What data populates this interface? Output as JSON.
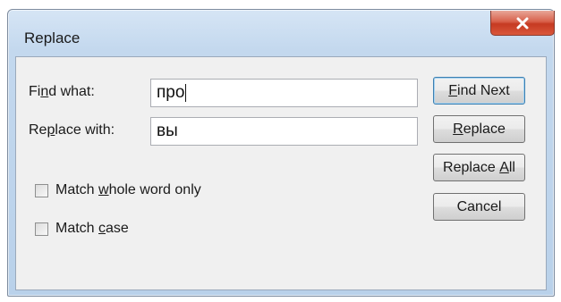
{
  "window": {
    "title": "Replace"
  },
  "find": {
    "label_pre": "Fi",
    "label_key": "n",
    "label_post": "d what:",
    "value": "про"
  },
  "replace": {
    "label_pre": "Re",
    "label_key": "p",
    "label_post": "lace with:",
    "value": "вы"
  },
  "options": {
    "whole_word": {
      "pre": "Match ",
      "key": "w",
      "post": "hole word only",
      "checked": false
    },
    "match_case": {
      "pre": "Match ",
      "key": "c",
      "post": "ase",
      "checked": false
    }
  },
  "buttons": {
    "find_next": {
      "key": "F",
      "rest": "ind Next"
    },
    "replace": {
      "key": "R",
      "rest": "eplace"
    },
    "replace_all": {
      "pre": "Replace ",
      "key": "A",
      "rest": "ll"
    },
    "cancel": {
      "label": "Cancel"
    }
  },
  "colors": {
    "close_button": "#c63a22",
    "frame": "#c3d8ee"
  },
  "icons": {
    "close": "close-icon"
  }
}
